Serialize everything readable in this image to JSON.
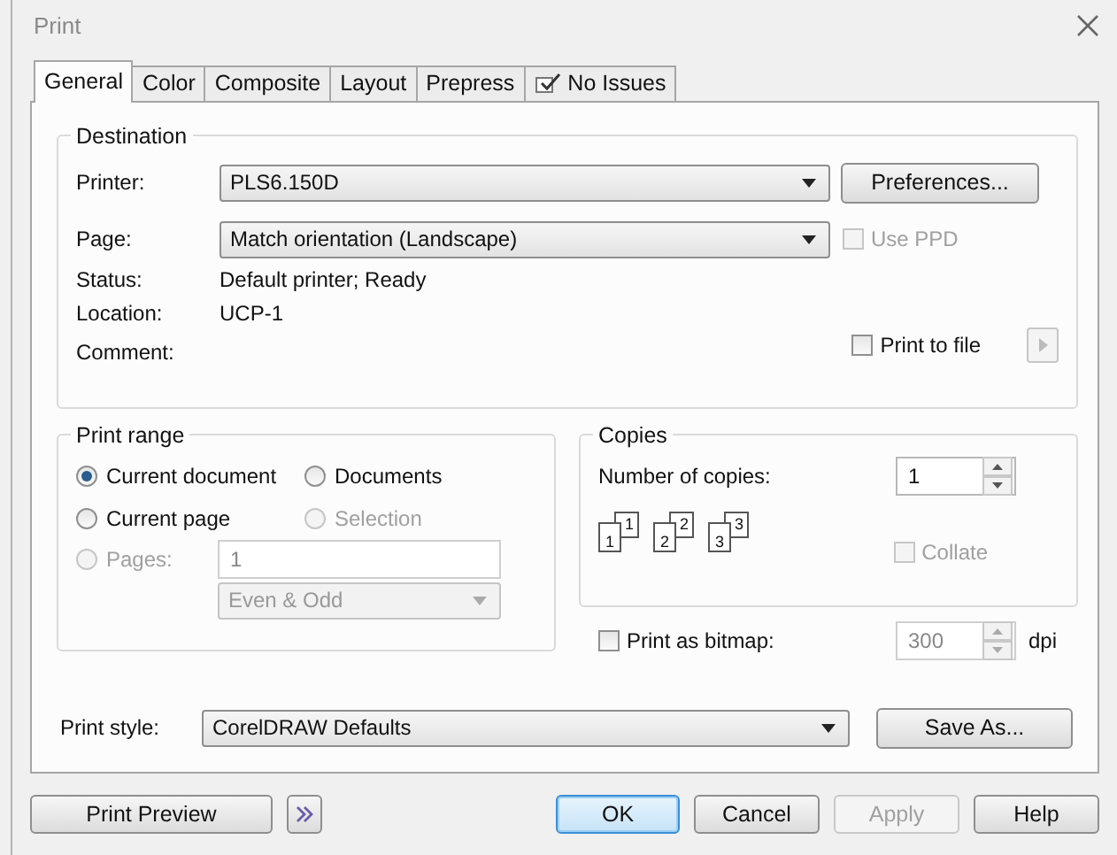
{
  "window": {
    "title": "Print"
  },
  "tabs": [
    {
      "label": "General",
      "selected": true,
      "kind": "text"
    },
    {
      "label": "Color",
      "selected": false,
      "kind": "text"
    },
    {
      "label": "Composite",
      "selected": false,
      "kind": "text"
    },
    {
      "label": "Layout",
      "selected": false,
      "kind": "text"
    },
    {
      "label": "Prepress",
      "selected": false,
      "kind": "text"
    },
    {
      "label": "No Issues",
      "selected": false,
      "kind": "status"
    }
  ],
  "destination": {
    "title": "Destination",
    "printer": {
      "label": "Printer:",
      "value": "PLS6.150D"
    },
    "preferences_button": "Preferences...",
    "page": {
      "label": "Page:",
      "value": "Match orientation (Landscape)"
    },
    "use_ppd": {
      "label": "Use PPD",
      "checked": false,
      "disabled": true
    },
    "status": {
      "label": "Status:",
      "value": "Default printer; Ready"
    },
    "location": {
      "label": "Location:",
      "value": "UCP-1"
    },
    "comment": {
      "label": "Comment:"
    },
    "print_to_file": {
      "label": "Print to file",
      "checked": false
    },
    "file_button": {
      "disabled": true
    }
  },
  "print_range": {
    "title": "Print range",
    "options": [
      {
        "label": "Current document",
        "selected": true,
        "disabled": false
      },
      {
        "label": "Documents",
        "selected": false,
        "disabled": false
      },
      {
        "label": "Current page",
        "selected": false,
        "disabled": false
      },
      {
        "label": "Selection",
        "selected": false,
        "disabled": true
      },
      {
        "label": "Pages:",
        "selected": false,
        "disabled": true
      }
    ],
    "pages_value": "1",
    "page_set": {
      "value": "Even & Odd",
      "disabled": true
    }
  },
  "copies": {
    "title": "Copies",
    "label": "Number of copies:",
    "value": "1",
    "collation_pages": [
      {
        "back": "1",
        "front": "1"
      },
      {
        "back": "2",
        "front": "2"
      },
      {
        "back": "3",
        "front": "3"
      }
    ],
    "collate": {
      "label": "Collate",
      "checked": false,
      "disabled": true
    }
  },
  "print_as_bitmap": {
    "label": "Print as bitmap:",
    "checked": false,
    "dpi": "300",
    "dpi_disabled": true,
    "unit": "dpi"
  },
  "print_style": {
    "label": "Print style:",
    "value": "CorelDRAW Defaults",
    "save_button": "Save As..."
  },
  "buttons": [
    {
      "label": "Print Preview",
      "kind": "preview",
      "disabled": false
    },
    {
      "kind": "expand",
      "disabled": false
    },
    {
      "label": "OK",
      "kind": "default",
      "disabled": false
    },
    {
      "label": "Cancel",
      "kind": "normal",
      "disabled": false
    },
    {
      "label": "Apply",
      "kind": "normal",
      "disabled": true
    },
    {
      "label": "Help",
      "kind": "normal",
      "disabled": false
    }
  ]
}
